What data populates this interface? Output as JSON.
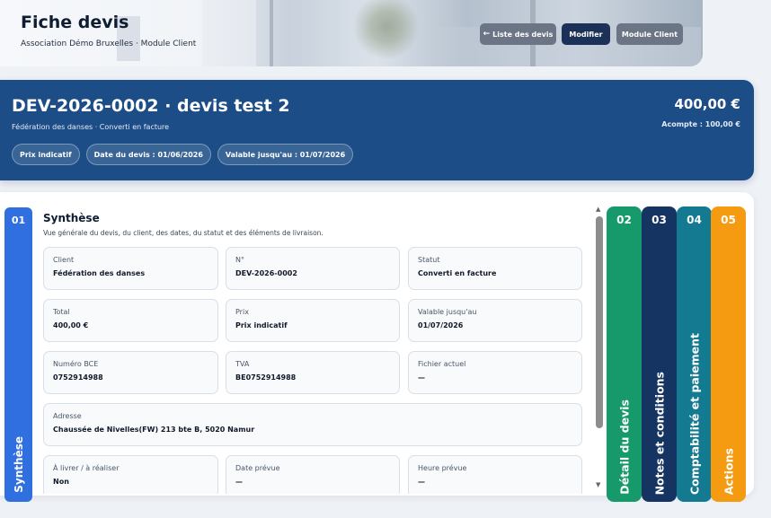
{
  "header": {
    "title": "Fiche devis",
    "subtitle": "Association Démo Bruxelles · Module Client",
    "buttons": {
      "list_label": "Liste des devis",
      "edit_label": "Modifier",
      "client_label": "Module Client"
    }
  },
  "hero": {
    "title": "DEV-2026-0002 · devis test 2",
    "subtitle": "Fédération des danses · Converti en facture",
    "amount": "400,00 €",
    "deposit": "Acompte : 100,00 €",
    "chips": [
      "Prix indicatif",
      "Date du devis : 01/06/2026",
      "Valable jusqu'au : 01/07/2026"
    ]
  },
  "tabs": {
    "left": {
      "num": "01",
      "label": "Synthèse"
    },
    "right": [
      {
        "num": "02",
        "label": "Détail du devis",
        "color": "#169a6c"
      },
      {
        "num": "03",
        "label": "Notes et conditions",
        "color": "#163462"
      },
      {
        "num": "04",
        "label": "Comptabilité et paiement",
        "color": "#137a92"
      },
      {
        "num": "05",
        "label": "Actions",
        "color": "#f49b12"
      }
    ]
  },
  "section": {
    "title": "Synthèse",
    "description": "Vue générale du devis, du client, des dates, du statut et des éléments de livraison.",
    "fields": [
      {
        "label": "Client",
        "value": "Fédération des danses"
      },
      {
        "label": "N°",
        "value": "DEV-2026-0002"
      },
      {
        "label": "Statut",
        "value": "Converti en facture"
      },
      {
        "label": "Total",
        "value": "400,00 €"
      },
      {
        "label": "Prix",
        "value": "Prix indicatif"
      },
      {
        "label": "Valable jusqu'au",
        "value": "01/07/2026"
      },
      {
        "label": "Numéro BCE",
        "value": "0752914988"
      },
      {
        "label": "TVA",
        "value": "BE0752914988"
      },
      {
        "label": "Fichier actuel",
        "value": "—"
      },
      {
        "label": "Adresse",
        "value": "Chaussée de Nivelles(FW) 213 bte B, 5020 Namur"
      },
      {
        "label": "À livrer / à réaliser",
        "value": "Non"
      },
      {
        "label": "Date prévue",
        "value": "—"
      },
      {
        "label": "Heure prévue",
        "value": "—"
      }
    ]
  },
  "colors": {
    "hero_bg": "#1c4d87",
    "tab_synthese": "#2f6fe0",
    "button_dark": "#1c3158",
    "button_grey": "#6b7585"
  }
}
